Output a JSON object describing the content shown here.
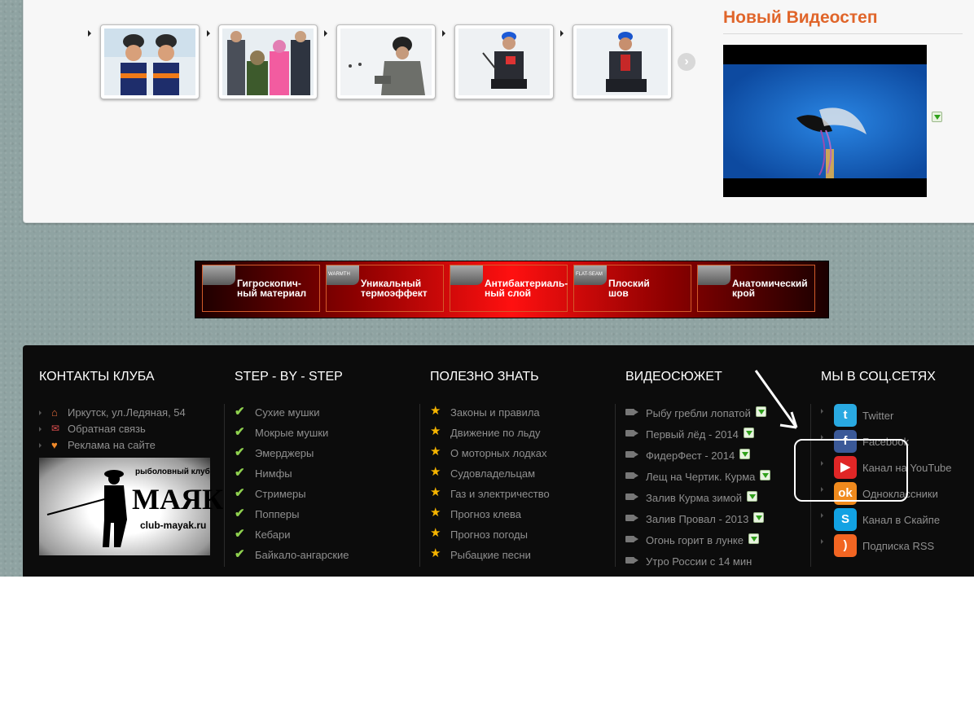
{
  "video": {
    "title": "Новый Видеостеп"
  },
  "banner": {
    "items": [
      {
        "label": "Гигроскопич-\nный материал"
      },
      {
        "label": "Уникальный\nтермоэффект",
        "badge": "WARMTH"
      },
      {
        "label": "Антибактериаль-\nный слой"
      },
      {
        "label": "Плоский\nшов",
        "badge": "FLAT-SEAM"
      },
      {
        "label": "Анатомический\nкрой"
      }
    ]
  },
  "footer": {
    "contacts": {
      "title": "КОНТАКТЫ КЛУБА",
      "items": [
        "Иркутск, ул.Ледяная, 54",
        "Обратная связь",
        "Реклама на сайте"
      ],
      "logo_text_main": "МАЯК",
      "logo_text_top": "рыболовный клуб",
      "logo_text_url": "club-mayak.ru"
    },
    "steps": {
      "title": "STEP - BY - STEP",
      "items": [
        "Сухие мушки",
        "Мокрые мушки",
        "Эмерджеры",
        "Нимфы",
        "Стримеры",
        "Попперы",
        "Кебари",
        "Байкало-ангарские"
      ]
    },
    "useful": {
      "title": "ПОЛЕЗНО ЗНАТЬ",
      "items": [
        "Законы и правила",
        "Движение по льду",
        "О моторных лодках",
        "Судовладельцам",
        "Газ и электричество",
        "Прогноз клева",
        "Прогноз погоды",
        "Рыбацкие песни"
      ]
    },
    "videos": {
      "title": "ВИДЕОСЮЖЕТ",
      "items": [
        "Рыбу гребли лопатой",
        "Первый лёд - 2014",
        "ФидерФест - 2014",
        "Лещ на Чертик. Курма",
        "Залив Курма зимой",
        "Залив Провал - 2013",
        "Огонь горит в лунке",
        "Утро России с 14 мин"
      ]
    },
    "social": {
      "title": "МЫ В СОЦ.СЕТЯХ",
      "items": [
        "Twitter",
        "Facebook",
        "Канал на YouTube",
        "Одноклассники",
        "Канал в Скайпе",
        "Подписка RSS"
      ]
    }
  },
  "colors": {
    "accent": "#e0652a",
    "footer_bg": "#0c0c0c",
    "page_bg": "#8fa3a2"
  }
}
